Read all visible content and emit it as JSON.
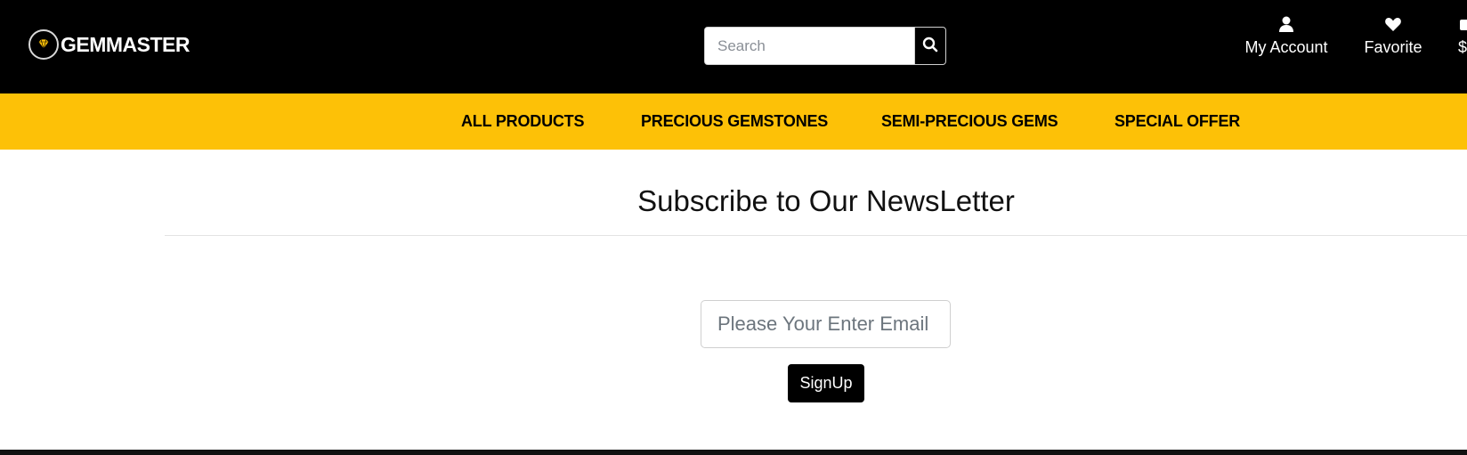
{
  "brand": {
    "name": "GEMMASTER",
    "accent": "#fdc107"
  },
  "search": {
    "placeholder": "Search",
    "value": "",
    "icon": "search-icon"
  },
  "header_nav": [
    {
      "label": "My Account",
      "icon": "user-icon"
    },
    {
      "label": "Favorite",
      "icon": "heart-icon"
    },
    {
      "label": "$",
      "icon": "cart-icon"
    }
  ],
  "categories": [
    "ALL PRODUCTS",
    "PRECIOUS GEMSTONES",
    "SEMI-PRECIOUS GEMS",
    "SPECIAL OFFER"
  ],
  "newsletter": {
    "title": "Subscribe to Our NewsLetter",
    "email_placeholder": "Please Your Enter Email",
    "email_value": "",
    "button_label": "SignUp"
  }
}
